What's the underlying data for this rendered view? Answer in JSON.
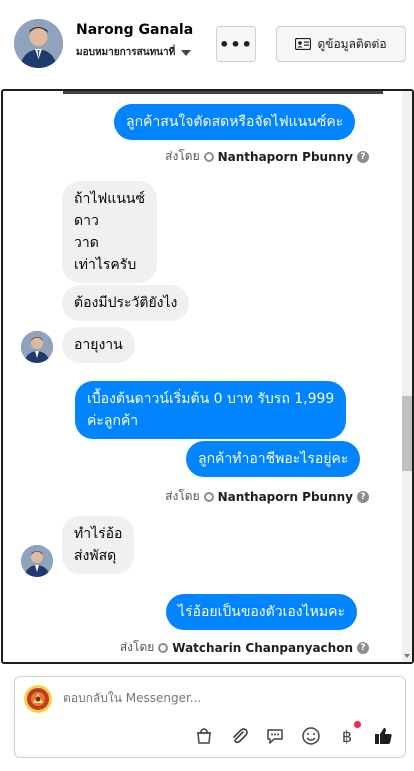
{
  "header": {
    "name": "Narong Ganala",
    "assignee": "มอบหมายการสนทนาที่",
    "more_label": "•••",
    "info_button": "ดูข้อมูลติดต่อ"
  },
  "messages": [
    {
      "dir": "out",
      "text": [
        "ลูกค้าสนใจตัดสดหรือจัดไฟแนนซ์คะ"
      ]
    },
    {
      "dir": "in",
      "text": [
        "ถ้าไฟแนนซ์",
        "ดาว",
        "วาด",
        "เท่าไรครับ"
      ]
    },
    {
      "dir": "in",
      "text": [
        "ต้องมีประวัติยังไง"
      ]
    },
    {
      "dir": "in",
      "text": [
        "อายุงาน"
      ]
    },
    {
      "dir": "out",
      "text": [
        "เบื้องต้นดาวน์เริ่มต้น 0 บาท รับรถ 1,999",
        "ค่ะลูกค้า"
      ]
    },
    {
      "dir": "out",
      "text": [
        "ลูกค้าทำอาชีพอะไรอยู่คะ"
      ]
    },
    {
      "dir": "in",
      "text": [
        "ทำไร่อ้อ",
        "ส่งพัสดุ"
      ]
    },
    {
      "dir": "out",
      "text": [
        "ไร่อ้อยเป็นของตัวเองไหมคะ"
      ]
    }
  ],
  "sent_by": {
    "prefix": "ส่งโดย",
    "agent1": "Nanthaporn Pbunny",
    "agent2": "Nanthaporn Pbunny",
    "agent3": "Watcharin Chanpanyachon",
    "help": "?"
  },
  "composer": {
    "placeholder": "ตอบกลับใน Messenger...",
    "tools": [
      "bag-icon",
      "paperclip-icon",
      "saved-replies-icon",
      "emoji-icon",
      "baht-icon",
      "like-icon"
    ]
  },
  "colors": {
    "outgoing": "#0084ff",
    "incoming": "#f1f0f0",
    "notification": "#f02849"
  }
}
